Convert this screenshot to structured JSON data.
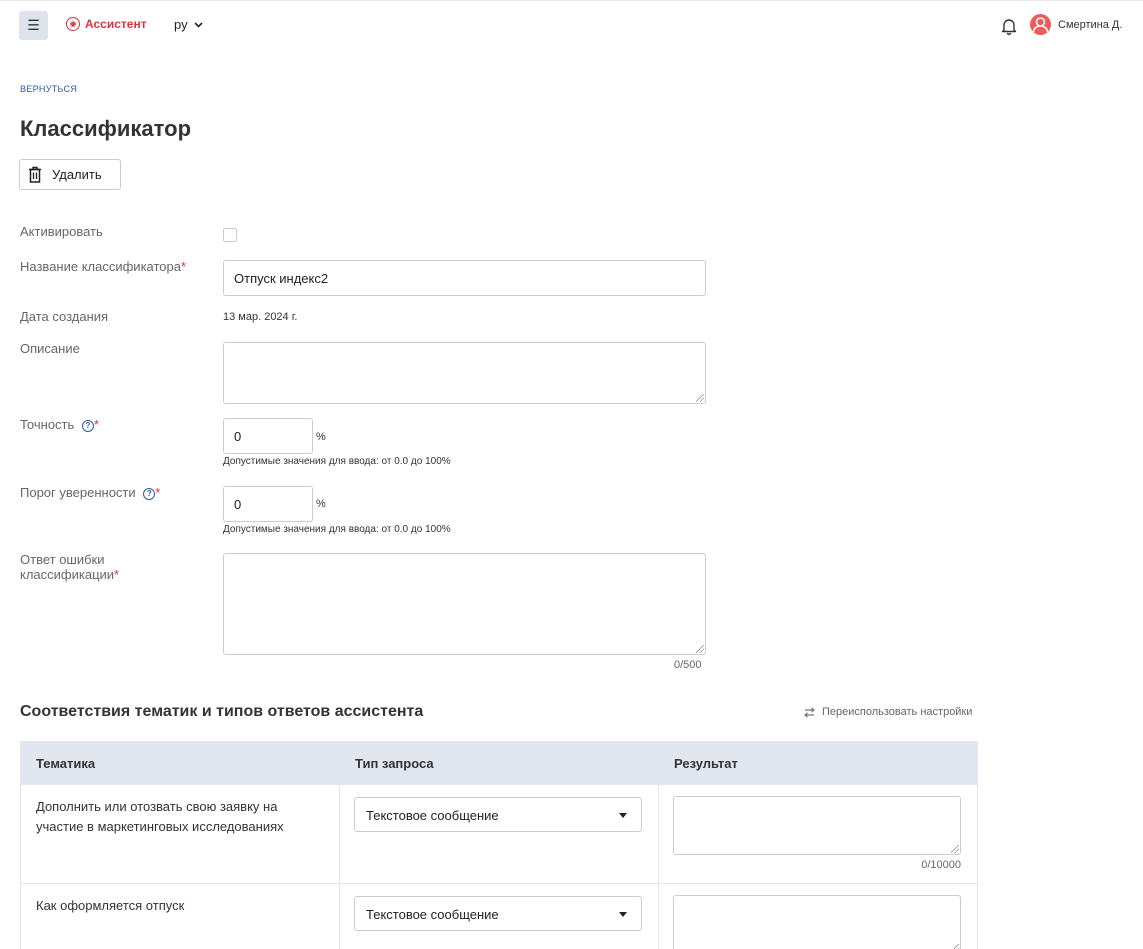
{
  "header": {
    "menu_icon": "hamburger-icon",
    "brand_name": "Ассистент",
    "language": "ру",
    "user_name": "Смертина Д."
  },
  "back_link": "ВЕРНУТЬСЯ",
  "page_title": "Классификатор",
  "delete_button": "Удалить",
  "form": {
    "activate_label": "Активировать",
    "activate_checked": false,
    "name_label": "Название классификатора",
    "name_value": "Отпуск индекс2",
    "created_label": "Дата создания",
    "created_value": "13 мар. 2024 г.",
    "description_label": "Описание",
    "description_value": "",
    "accuracy_label": "Точность",
    "accuracy_value": "0",
    "accuracy_unit": "%",
    "accuracy_hint": "Допустимые значения для ввода: от 0.0 до 100%",
    "threshold_label": "Порог уверенности",
    "threshold_value": "0",
    "threshold_unit": "%",
    "threshold_hint": "Допустимые значения для ввода: от 0.0 до 100%",
    "error_label_line1": "Ответ ошибки",
    "error_label_line2": "классификации",
    "error_value": "",
    "error_counter": "0/500",
    "required_mark": "*",
    "help_glyph": "?"
  },
  "mapping": {
    "title": "Соответствия тематик и типов ответов ассистента",
    "reuse_link": "Переиспользовать настройки",
    "columns": [
      "Тематика",
      "Тип запроса",
      "Результат"
    ],
    "rows": [
      {
        "topic": "Дополнить или отозвать свою заявку на участие в маркетинговых исследованиях",
        "request_type": "Текстовое сообщение",
        "result": "",
        "counter": "0/10000"
      },
      {
        "topic": "Как оформляется отпуск",
        "request_type": "Текстовое сообщение",
        "result": "",
        "counter": ""
      }
    ]
  }
}
